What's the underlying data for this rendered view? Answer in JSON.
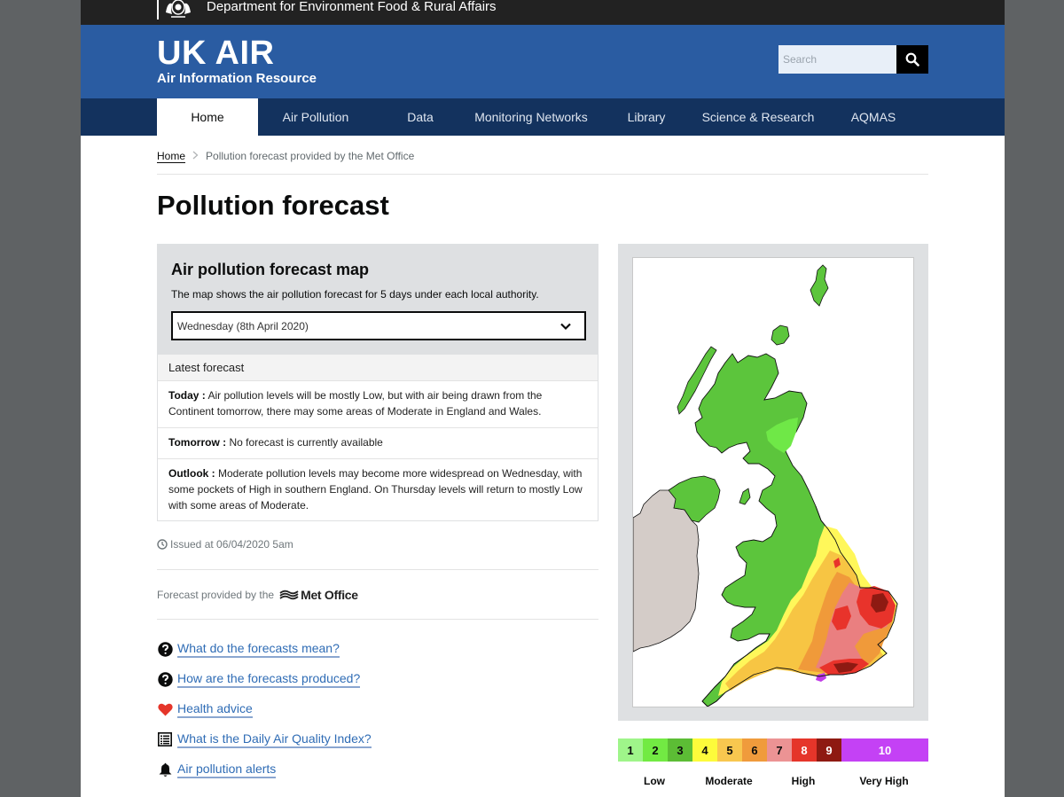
{
  "gov_bar": {
    "department": "Department for Environment Food & Rural Affairs",
    "crest_icon": "royal-crest-icon"
  },
  "header": {
    "title": "UK AIR",
    "subtitle": "Air Information Resource",
    "search": {
      "placeholder": "Search",
      "value": "",
      "button_icon": "search-icon"
    }
  },
  "nav": {
    "items": [
      {
        "label": "Home",
        "active": true
      },
      {
        "label": "Air Pollution",
        "active": false
      },
      {
        "label": "Data",
        "active": false
      },
      {
        "label": "Monitoring Networks",
        "active": false
      },
      {
        "label": "Library",
        "active": false
      },
      {
        "label": "Science & Research",
        "active": false
      },
      {
        "label": "AQMAS",
        "active": false
      }
    ]
  },
  "breadcrumb": {
    "home": "Home",
    "separator": ">",
    "current": "Pollution forecast provided by the Met Office"
  },
  "page_title": "Pollution forecast",
  "forecast_panel": {
    "title": "Air pollution forecast map",
    "description": "The map shows the air pollution forecast for 5 days under each local authority.",
    "day_select": {
      "selected": "Wednesday (8th April 2020)"
    },
    "latest_heading": "Latest forecast",
    "rows": [
      {
        "label": "Today :",
        "text": " Air pollution levels will be mostly Low, but with air being drawn from the Continent tomorrow, there may some areas of Moderate in England and Wales."
      },
      {
        "label": "Tomorrow :",
        "text": " No forecast is currently available"
      },
      {
        "label": "Outlook :",
        "text": " Moderate pollution levels may become more widespread on Wednesday, with some pockets of High in southern England. On Thursday levels will return to mostly Low with some areas of Moderate."
      }
    ]
  },
  "issued": "Issued at 06/04/2020 5am",
  "provided_by": {
    "text": "Forecast provided by the",
    "logo_text": "Met Office"
  },
  "links": [
    {
      "label": "What do the forecasts mean?",
      "icon": "question-circle-icon"
    },
    {
      "label": "How are the forecasts produced?",
      "icon": "question-circle-icon"
    },
    {
      "label": "Health advice",
      "icon": "heart-icon"
    },
    {
      "label": "What is the Daily Air Quality Index?",
      "icon": "list-icon"
    },
    {
      "label": "Air pollution alerts",
      "icon": "bell-icon"
    }
  ],
  "map": {
    "description": "UK air pollution forecast map; mostly Low (green) in Scotland, Northern Ireland, Wales and northern England; Moderate to High across south and east England; a small Very High spot on the south coast.",
    "colors": {
      "land_low": "#5cc53c",
      "low_2": "#6fe847",
      "mod_4": "#fff75a",
      "mod_5": "#f7c543",
      "mod_6": "#f09a3a",
      "high_7": "#ea7f80",
      "high_8": "#e8332b",
      "high_9": "#8e1a12",
      "very_high": "#c03be8",
      "ireland": "#d4ccc8",
      "sea": "#ffffff"
    }
  },
  "legend": {
    "bands": [
      {
        "value": "1",
        "color": "#9ff58a",
        "text_color": "#0b0c0c"
      },
      {
        "value": "2",
        "color": "#72ea43",
        "text_color": "#0b0c0c"
      },
      {
        "value": "3",
        "color": "#5cbd35",
        "text_color": "#0b0c0c"
      },
      {
        "value": "4",
        "color": "#fdfb3b",
        "text_color": "#0b0c0c"
      },
      {
        "value": "5",
        "color": "#f8c74f",
        "text_color": "#0b0c0c"
      },
      {
        "value": "6",
        "color": "#f09b3c",
        "text_color": "#0b0c0c"
      },
      {
        "value": "7",
        "color": "#ec9394",
        "text_color": "#0b0c0c"
      },
      {
        "value": "8",
        "color": "#e5352a",
        "text_color": "#ffffff"
      },
      {
        "value": "9",
        "color": "#8e1a12",
        "text_color": "#ffffff"
      },
      {
        "value": "10",
        "color": "#c441f5",
        "text_color": "#ffffff"
      }
    ],
    "labels": [
      "Low",
      "Moderate",
      "High",
      "Very High"
    ]
  }
}
